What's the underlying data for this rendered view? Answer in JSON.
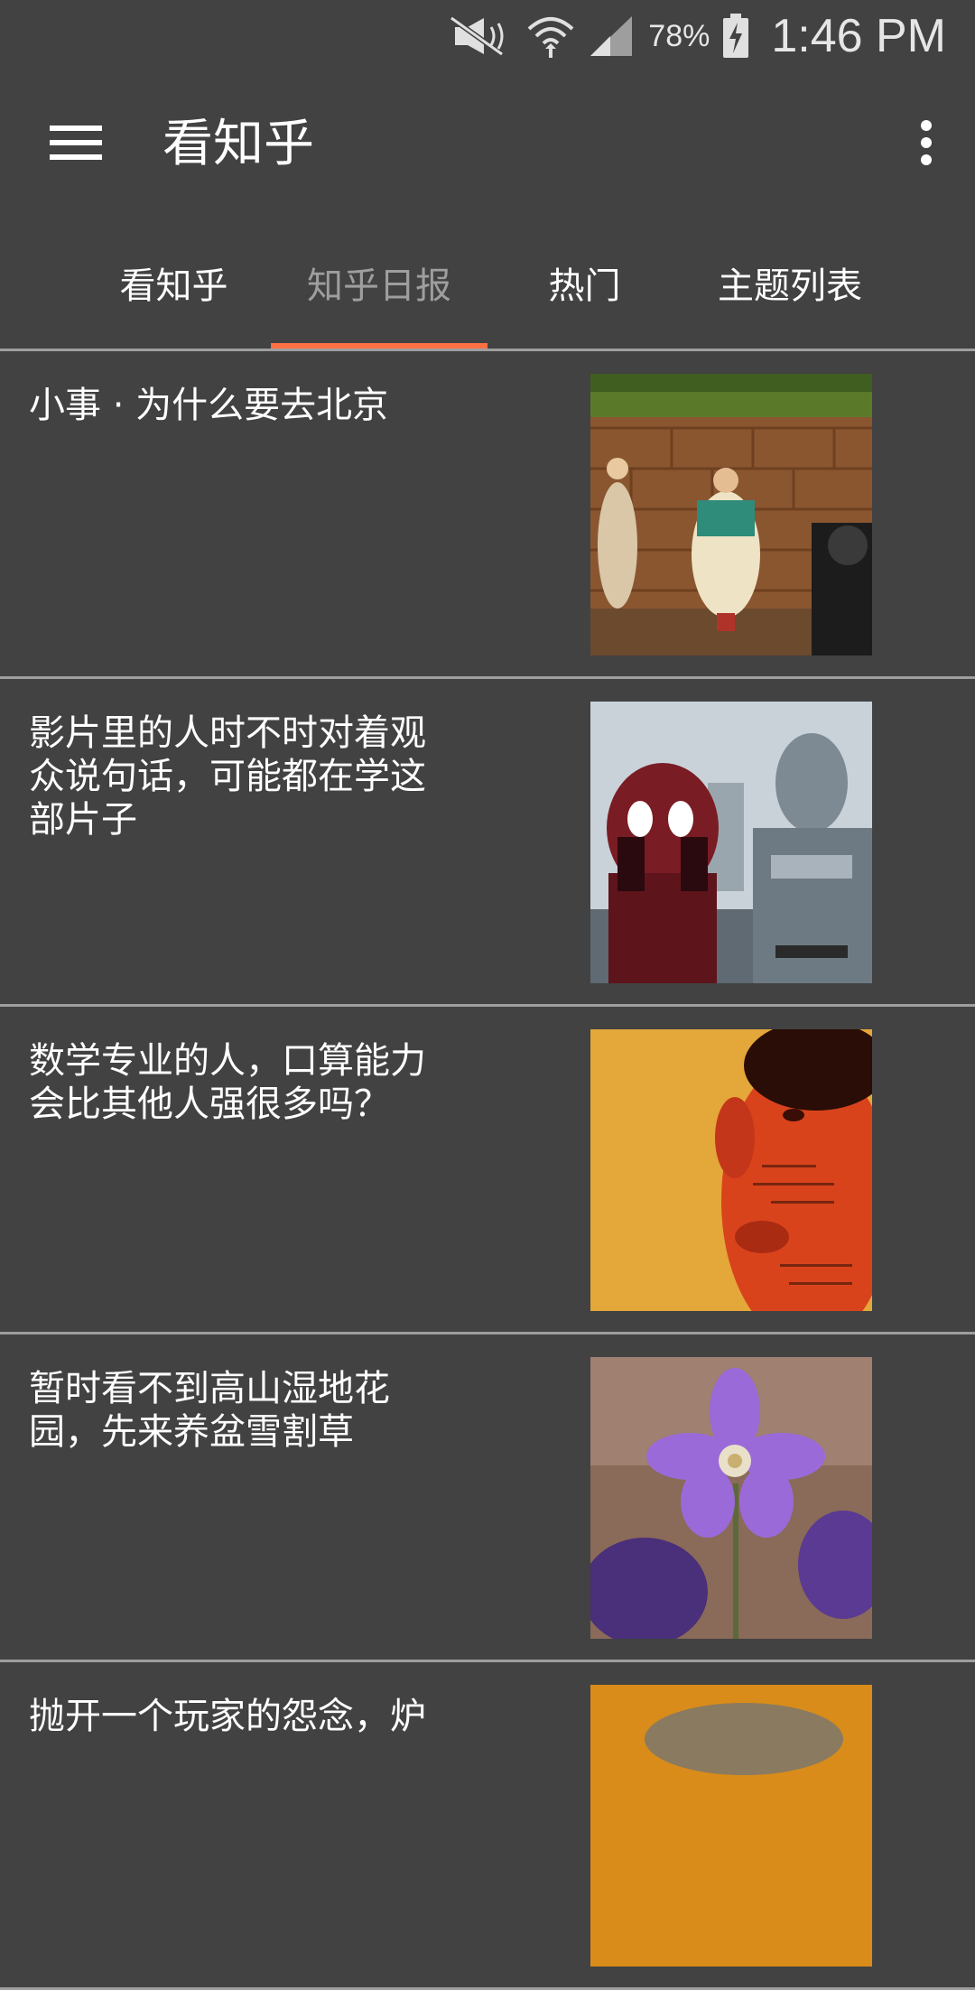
{
  "status_bar": {
    "battery_percent": "78%",
    "time": "1:46 PM",
    "icons": [
      "mute-icon",
      "wifi-icon",
      "signal-icon",
      "battery-charging-icon"
    ]
  },
  "toolbar": {
    "title": "看知乎",
    "menu_icon": "hamburger-menu-icon",
    "overflow_icon": "more-vert-icon"
  },
  "tabs": [
    {
      "label": "看知乎",
      "active": false
    },
    {
      "label": "知乎日报",
      "active": true
    },
    {
      "label": "热门",
      "active": false
    },
    {
      "label": "主题列表",
      "active": false
    }
  ],
  "colors": {
    "background": "#424242",
    "accent": "#ff7043",
    "divider": "#9e9e9e",
    "inactive_tab": "#9e9e9e"
  },
  "stories": [
    {
      "title": "小事 · 为什么要去北京"
    },
    {
      "title": "影片里的人时不时对着观众说句话，可能都在学这部片子"
    },
    {
      "title": "数学专业的人，口算能力会比其他人强很多吗？"
    },
    {
      "title": "暂时看不到高山湿地花园，先来养盆雪割草"
    },
    {
      "title": "抛开一个玩家的怨念，炉"
    }
  ]
}
